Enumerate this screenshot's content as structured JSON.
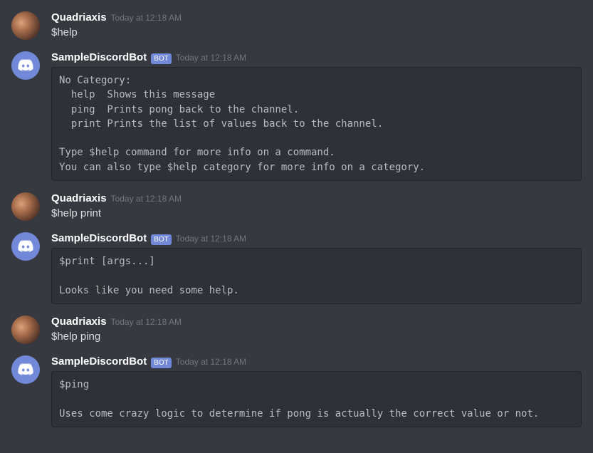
{
  "bot_badge": "BOT",
  "messages": [
    {
      "author": "Quadriaxis",
      "is_bot": false,
      "timestamp": "Today at 12:18 AM",
      "text": "$help",
      "code": null
    },
    {
      "author": "SampleDiscordBot",
      "is_bot": true,
      "timestamp": "Today at 12:18 AM",
      "text": null,
      "code": "No Category:\n  help  Shows this message\n  ping  Prints pong back to the channel.\n  print Prints the list of values back to the channel.\n\nType $help command for more info on a command.\nYou can also type $help category for more info on a category."
    },
    {
      "author": "Quadriaxis",
      "is_bot": false,
      "timestamp": "Today at 12:18 AM",
      "text": "$help print",
      "code": null
    },
    {
      "author": "SampleDiscordBot",
      "is_bot": true,
      "timestamp": "Today at 12:18 AM",
      "text": null,
      "code": "$print [args...]\n\nLooks like you need some help."
    },
    {
      "author": "Quadriaxis",
      "is_bot": false,
      "timestamp": "Today at 12:18 AM",
      "text": "$help ping",
      "code": null
    },
    {
      "author": "SampleDiscordBot",
      "is_bot": true,
      "timestamp": "Today at 12:18 AM",
      "text": null,
      "code": "$ping\n\nUses come crazy logic to determine if pong is actually the correct value or not."
    }
  ]
}
